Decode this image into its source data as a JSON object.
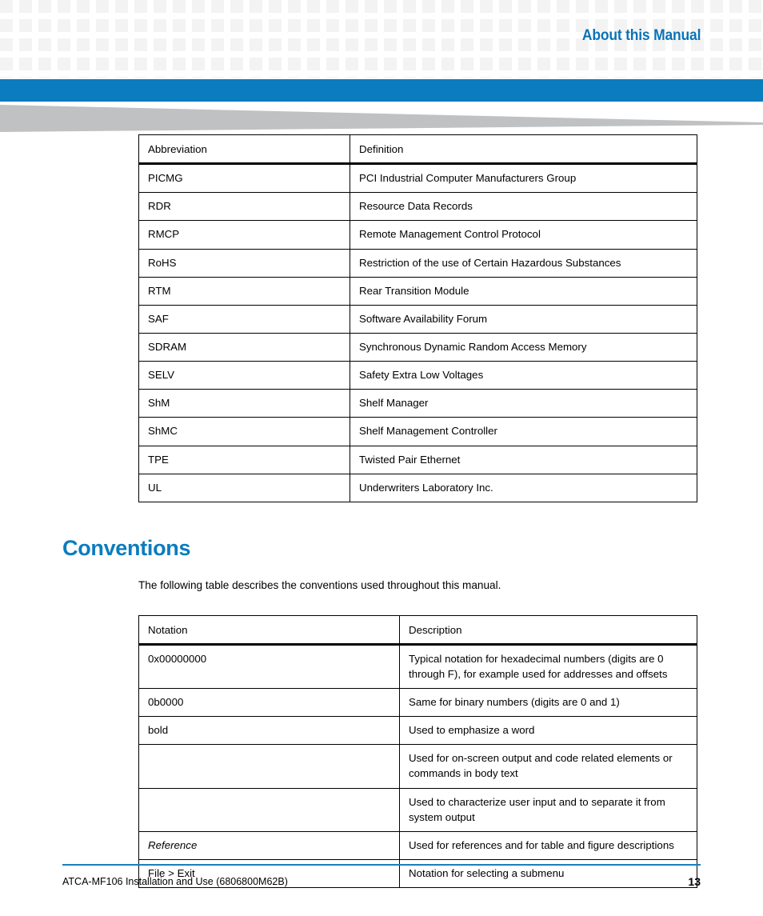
{
  "header": {
    "title": "About this Manual",
    "accent_color": "#0b7cbe",
    "swoosh_color": "#bfc1c3"
  },
  "abbreviation_table": {
    "name": "abbreviations",
    "columns": [
      "Abbreviation",
      "Definition"
    ],
    "rows": [
      [
        "PICMG",
        "PCI Industrial Computer Manufacturers Group"
      ],
      [
        "RDR",
        "Resource Data Records"
      ],
      [
        "RMCP",
        "Remote Management Control Protocol"
      ],
      [
        "RoHS",
        "Restriction of the use of Certain Hazardous Substances"
      ],
      [
        "RTM",
        "Rear Transition Module"
      ],
      [
        "SAF",
        "Software Availability Forum"
      ],
      [
        "SDRAM",
        "Synchronous Dynamic Random Access Memory"
      ],
      [
        "SELV",
        "Safety Extra Low Voltages"
      ],
      [
        "ShM",
        "Shelf Manager"
      ],
      [
        "ShMC",
        "Shelf Management Controller"
      ],
      [
        "TPE",
        "Twisted Pair Ethernet"
      ],
      [
        "UL",
        "Underwriters Laboratory Inc."
      ]
    ]
  },
  "conventions_section": {
    "heading": "Conventions",
    "intro": "The following table describes the conventions used throughout this manual."
  },
  "conventions_table": {
    "name": "conventions",
    "columns": [
      "Notation",
      "Description"
    ],
    "rows": [
      {
        "notation": "0x00000000",
        "description": "Typical notation for hexadecimal numbers (digits are 0 through F), for example used for addresses and offsets",
        "style": "normal"
      },
      {
        "notation": "0b0000",
        "description": "Same for binary numbers (digits are 0 and 1)",
        "style": "normal"
      },
      {
        "notation": "bold",
        "description": "Used to emphasize a word",
        "style": "normal"
      },
      {
        "notation": "",
        "description": "Used for on-screen output and code related elements or commands in body text",
        "style": "normal"
      },
      {
        "notation": "",
        "description": "Used to characterize user input and to separate it from system output",
        "style": "normal"
      },
      {
        "notation": "Reference",
        "description": "Used for references and for table and figure descriptions",
        "style": "italic"
      },
      {
        "notation": "File > Exit",
        "description": "Notation for selecting a submenu",
        "style": "normal"
      }
    ]
  },
  "footer": {
    "document_title": "ATCA-MF106 Installation and Use (6806800M62B)",
    "page_number": "13",
    "rule_color": "#1b7fbd"
  }
}
